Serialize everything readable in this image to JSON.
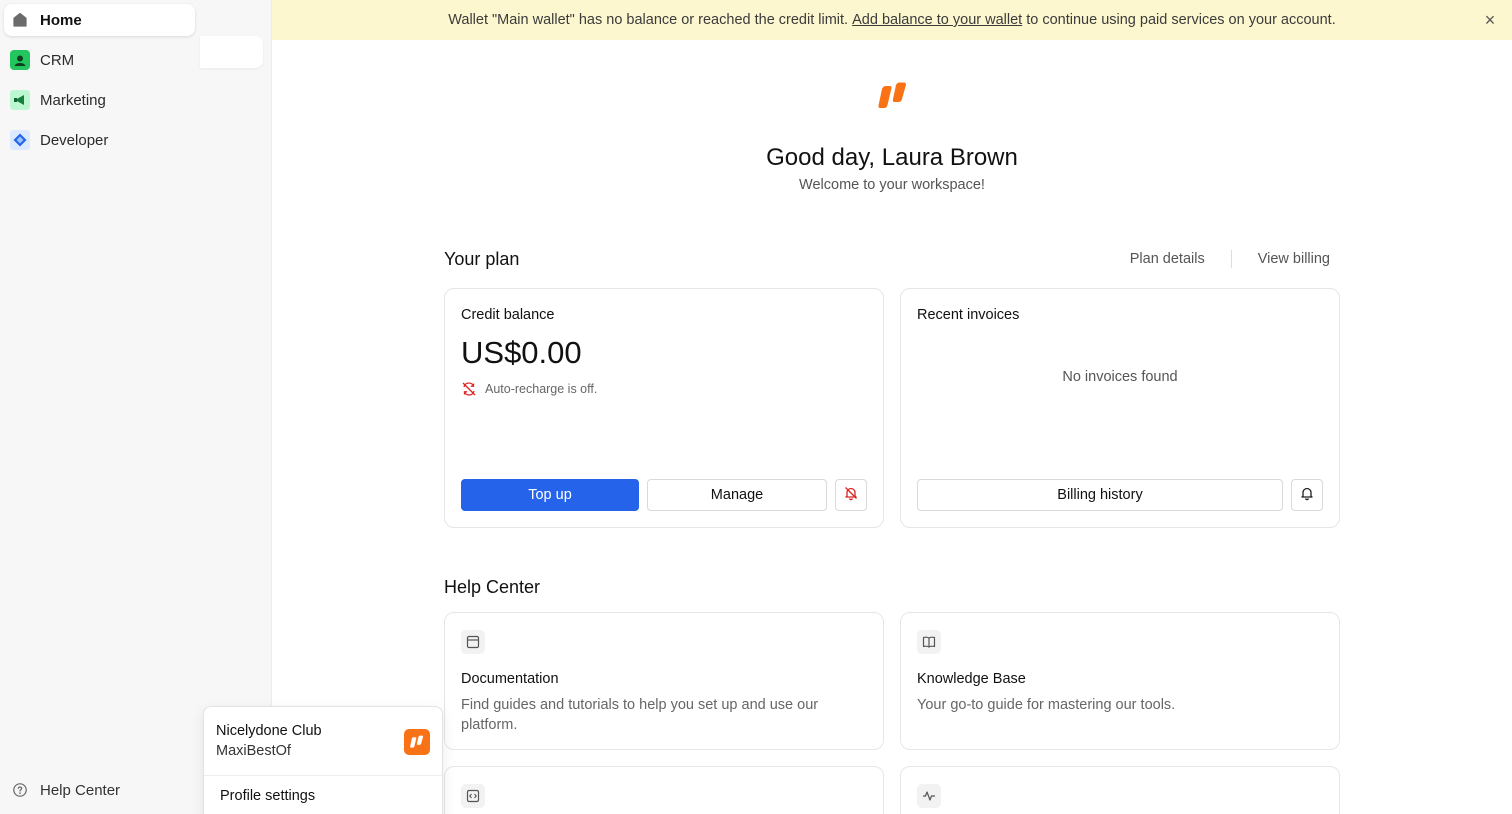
{
  "sidebar": {
    "items": [
      {
        "label": "Home",
        "icon": "home-icon"
      },
      {
        "label": "CRM",
        "icon": "crm-icon"
      },
      {
        "label": "Marketing",
        "icon": "marketing-icon"
      },
      {
        "label": "Developer",
        "icon": "developer-icon"
      }
    ],
    "help_label": "Help Center"
  },
  "banner": {
    "text_before": "Wallet \"Main wallet\" has no balance or reached the credit limit.",
    "link_text": "Add balance to your wallet",
    "text_after": "to continue using paid services on your account.",
    "bg_color": "#fdf7cf"
  },
  "hero": {
    "greeting": "Good day, Laura Brown",
    "welcome": "Welcome to your workspace!",
    "brand_color": "#f97316"
  },
  "plan": {
    "title": "Your plan",
    "links": [
      "Plan details",
      "View billing"
    ],
    "credit": {
      "title": "Credit balance",
      "amount": "US$0.00",
      "auto_recharge": "Auto-recharge is off.",
      "top_up_label": "Top up",
      "manage_label": "Manage"
    },
    "invoices": {
      "title": "Recent invoices",
      "empty": "No invoices found",
      "billing_history_label": "Billing history"
    },
    "accent_color": "#2563eb"
  },
  "help_center": {
    "title": "Help Center",
    "cards": [
      {
        "title": "Documentation",
        "description": "Find guides and tutorials to help you set up and use our platform.",
        "icon": "document-icon"
      },
      {
        "title": "Knowledge Base",
        "description": "Your go-to guide for mastering our tools.",
        "icon": "book-icon"
      },
      {
        "title": "",
        "description": "",
        "icon": "code-icon"
      },
      {
        "title": "",
        "description": "",
        "icon": "activity-icon"
      }
    ]
  },
  "workspace_popover": {
    "org_name": "Nicelydone Club",
    "sub_name": "MaxiBestOf",
    "profile_settings": "Profile settings"
  }
}
